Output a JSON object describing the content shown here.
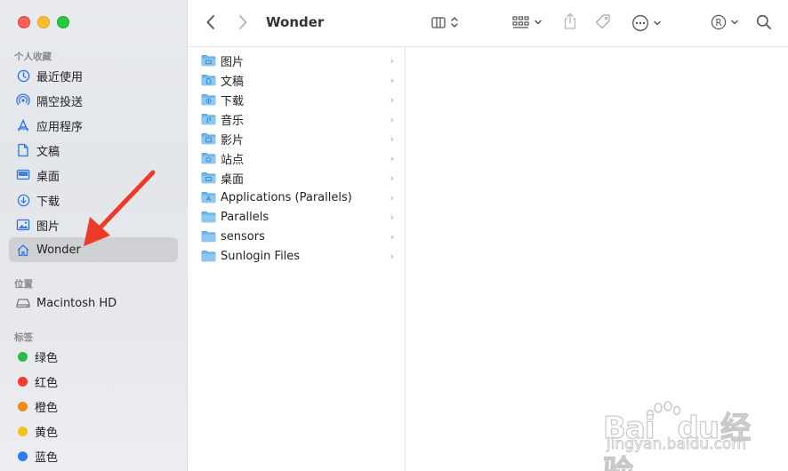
{
  "window": {
    "title": "Wonder"
  },
  "sidebar": {
    "favorites_title": "个人收藏",
    "favorites": [
      {
        "label": "最近使用",
        "icon": "clock-icon"
      },
      {
        "label": "隔空投送",
        "icon": "airdrop-icon"
      },
      {
        "label": "应用程序",
        "icon": "applications-icon"
      },
      {
        "label": "文稿",
        "icon": "document-icon"
      },
      {
        "label": "桌面",
        "icon": "desktop-icon"
      },
      {
        "label": "下载",
        "icon": "download-icon"
      },
      {
        "label": "图片",
        "icon": "photo-icon"
      },
      {
        "label": "Wonder",
        "icon": "home-icon",
        "selected": true
      }
    ],
    "locations_title": "位置",
    "locations": [
      {
        "label": "Macintosh HD",
        "icon": "disk-icon"
      }
    ],
    "tags_title": "标签",
    "tags": [
      {
        "label": "绿色",
        "color": "#2db84d"
      },
      {
        "label": "红色",
        "color": "#f23a30"
      },
      {
        "label": "橙色",
        "color": "#f28a1e"
      },
      {
        "label": "黄色",
        "color": "#f0c419"
      },
      {
        "label": "蓝色",
        "color": "#2f7bf5"
      }
    ]
  },
  "toolbar": {
    "title": "Wonder",
    "back_icon": "chevron-left-icon",
    "forward_icon": "chevron-right-icon",
    "view_icon": "column-view-icon",
    "group_icon": "grid-group-icon",
    "share_icon": "share-icon",
    "tag_icon": "tag-icon",
    "action_icon": "ellipsis-circle-icon",
    "registered_icon": "registered-icon",
    "search_icon": "search-icon"
  },
  "files": [
    {
      "name": "图片",
      "type": "pictures-folder"
    },
    {
      "name": "文稿",
      "type": "documents-folder"
    },
    {
      "name": "下载",
      "type": "downloads-folder"
    },
    {
      "name": "音乐",
      "type": "music-folder"
    },
    {
      "name": "影片",
      "type": "movies-folder"
    },
    {
      "name": "站点",
      "type": "sites-folder"
    },
    {
      "name": "桌面",
      "type": "desktop-folder"
    },
    {
      "name": "Applications (Parallels)",
      "type": "applications-folder"
    },
    {
      "name": "Parallels",
      "type": "folder"
    },
    {
      "name": "sensors",
      "type": "folder"
    },
    {
      "name": "Sunlogin Files",
      "type": "folder"
    }
  ],
  "annotation": {
    "color": "#ee3a28"
  },
  "watermark": {
    "brand": "Bai",
    "brand2": "du",
    "cn": "经验",
    "url": "jingyan.baidu.com"
  }
}
